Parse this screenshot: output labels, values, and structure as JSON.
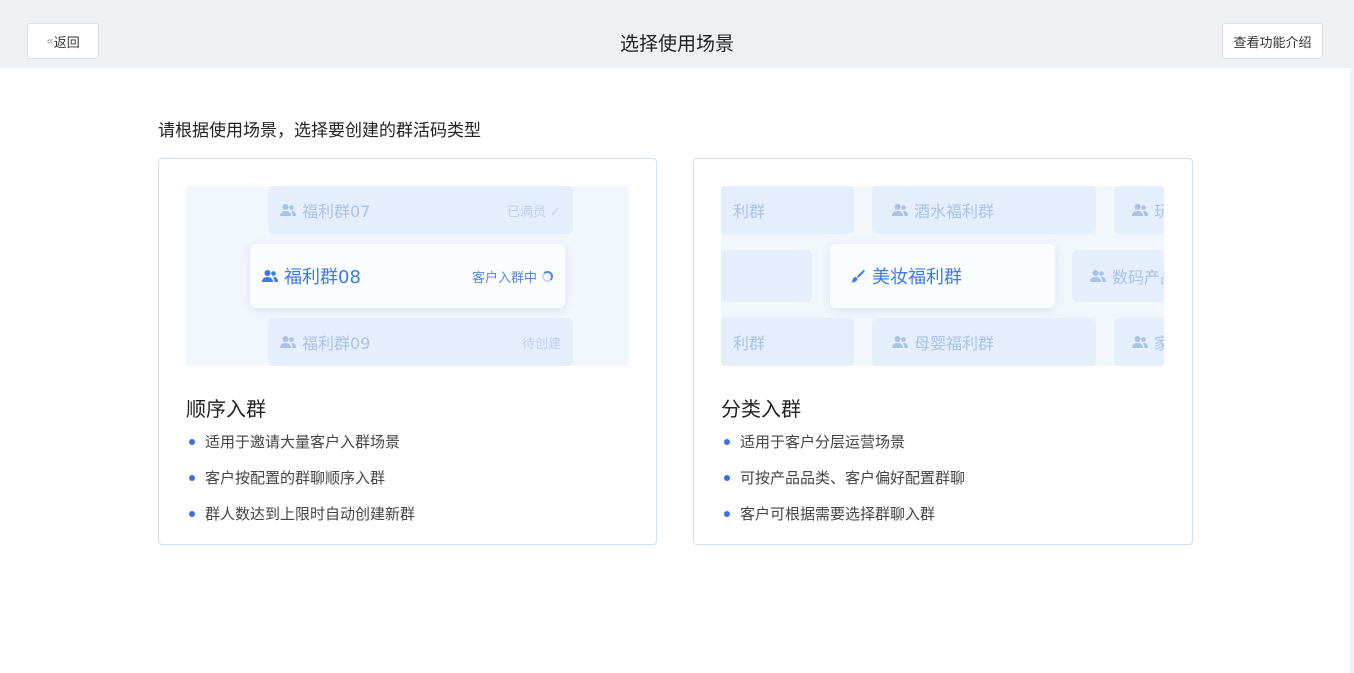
{
  "header": {
    "back_label": "返回",
    "title": "选择使用场景",
    "intro_label": "查看功能介绍"
  },
  "subtitle": "请根据使用场景，选择要创建的群活码类型",
  "cards": [
    {
      "title": "顺序入群",
      "preview": {
        "groups": [
          {
            "name": "福利群07",
            "state": "已满员 ✓"
          },
          {
            "name": "福利群08",
            "state": "客户入群中"
          },
          {
            "name": "福利群09",
            "state": "待创建"
          }
        ]
      },
      "bullets": [
        "适用于邀请大量客户入群场景",
        "客户按配置的群聊顺序入群",
        "群人数达到上限时自动创建新群"
      ]
    },
    {
      "title": "分类入群",
      "preview": {
        "groups": [
          {
            "name": "利群"
          },
          {
            "name": "酒水福利群"
          },
          {
            "name": "玩"
          },
          {
            "name": "美妆福利群"
          },
          {
            "name": "数码产品"
          },
          {
            "name": "利群"
          },
          {
            "name": "母婴福利群"
          },
          {
            "name": "家"
          }
        ]
      },
      "bullets": [
        "适用于客户分层运营场景",
        "可按产品品类、客户偏好配置群聊",
        "客户可根据需要选择群聊入群"
      ]
    }
  ],
  "colors": {
    "accent": "#3e6fd8",
    "card_border": "#cfe0f5",
    "header_bg": "#eef0f4"
  }
}
